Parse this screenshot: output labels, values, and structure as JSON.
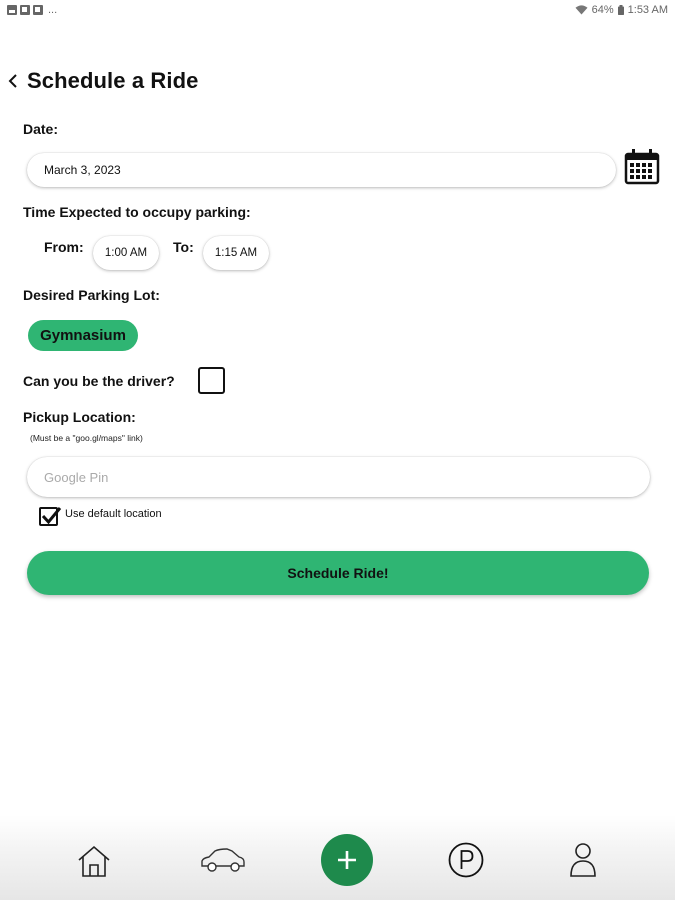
{
  "status_bar": {
    "battery": "64%",
    "time": "1:53 AM",
    "more": "..."
  },
  "header": {
    "title": "Schedule a Ride"
  },
  "form": {
    "date_label": "Date:",
    "date_value": "March 3, 2023",
    "time_label": "Time Expected to occupy parking:",
    "from_label": "From:",
    "from_value": "1:00 AM",
    "to_label": "To:",
    "to_value": "1:15 AM",
    "lot_label": "Desired Parking Lot:",
    "lot_value": "Gymnasium",
    "driver_label": "Can you be the driver?",
    "driver_checked": false,
    "pickup_label": "Pickup Location:",
    "pickup_note": "(Must be a \"goo.gl/maps\" link)",
    "pickup_placeholder": "Google Pin",
    "default_location_label": "Use default location",
    "default_location_checked": true,
    "submit_label": "Schedule Ride!"
  },
  "nav": {
    "items": [
      {
        "icon": "home-icon"
      },
      {
        "icon": "car-icon"
      },
      {
        "icon": "plus-icon"
      },
      {
        "icon": "parking-icon"
      },
      {
        "icon": "profile-icon"
      }
    ]
  },
  "colors": {
    "accent": "#2fb573",
    "add_button": "#1e8a4c"
  }
}
